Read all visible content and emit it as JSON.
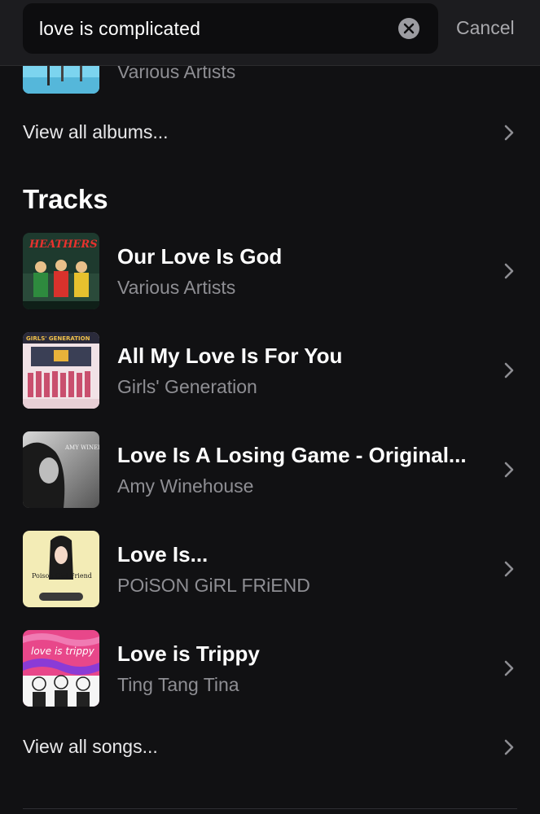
{
  "search": {
    "query": "love is complicated",
    "cancel_label": "Cancel"
  },
  "albums": {
    "partial_item_artist": "Various Artists",
    "view_all_label": "View all albums..."
  },
  "tracks": {
    "section_title": "Tracks",
    "items": [
      {
        "title": "Our Love Is God",
        "artist": "Various Artists",
        "art": "heathers-cover"
      },
      {
        "title": "All My Love Is For You",
        "artist": "Girls' Generation",
        "art": "girls-generation-cover"
      },
      {
        "title": "Love Is A Losing Game - Original...",
        "artist": "Amy Winehouse",
        "art": "amy-winehouse-cover"
      },
      {
        "title": "Love Is...",
        "artist": "POiSON GiRL FRiEND",
        "art": "poison-girl-friend-cover"
      },
      {
        "title": "Love is Trippy",
        "artist": "Ting Tang Tina",
        "art": "love-is-trippy-cover"
      }
    ],
    "view_all_label": "View all songs..."
  },
  "art_text": {
    "heathers": "HEATHERS",
    "girls_generation": "GIRLS' GENERATION",
    "amy": "AMY WINEHOUSE",
    "poison": "Poison Girl Friend",
    "trippy": "love is trippy"
  },
  "colors": {
    "background": "#111113",
    "header": "#1c1c1f",
    "search_field": "#0d0d0f",
    "secondary_text": "#8e8e93",
    "chevron": "#8e8e93"
  }
}
